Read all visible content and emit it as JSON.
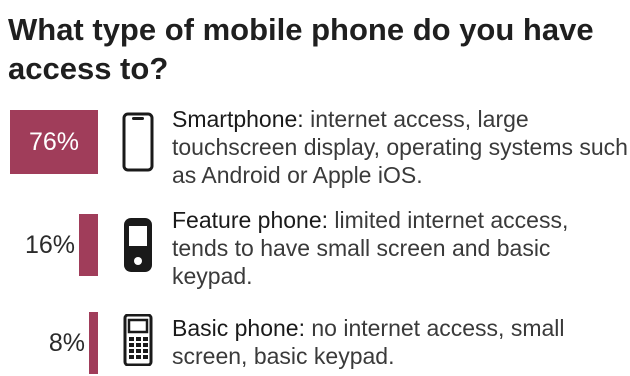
{
  "title": "What type of mobile phone do you have access to?",
  "colors": {
    "bar": "#a03d5a",
    "text": "#2b2b2b"
  },
  "chart_data": {
    "type": "bar",
    "categories": [
      "Smartphone",
      "Feature phone",
      "Basic phone"
    ],
    "values": [
      76,
      16,
      8
    ],
    "unit": "%",
    "value_labels": [
      "76%",
      "16%",
      "8%"
    ]
  },
  "items": [
    {
      "name": "Smartphone:",
      "description": " internet access, large touchscreen display, operating systems such as Android or Apple iOS.",
      "icon": "smartphone-icon"
    },
    {
      "name": "Feature phone:",
      "description": " limited internet access, tends to have small screen and basic keypad.",
      "icon": "feature-phone-icon"
    },
    {
      "name": "Basic phone:",
      "description": " no internet access, small screen, basic keypad.",
      "icon": "basic-phone-icon"
    }
  ]
}
